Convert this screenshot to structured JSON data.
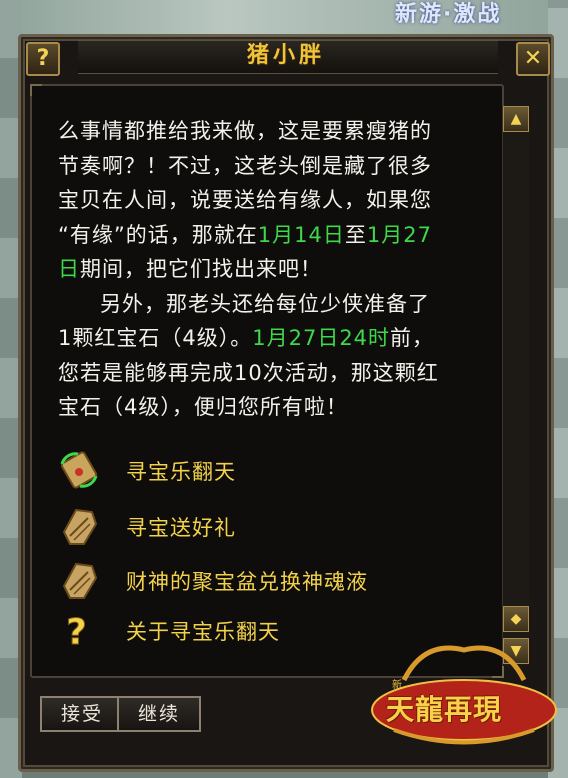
{
  "background": {
    "top_text": "新游·激战"
  },
  "title": "猪小胖",
  "title_bar": {
    "help_icon": "question-icon",
    "close_icon": "close-icon"
  },
  "dialogue": {
    "p1_l1": "么事情都推给我来做，这是要累瘦猪的",
    "p1_l2": "节奏啊？！不过，这老头倒是藏了很多",
    "p1_l3": "宝贝在人间，说要送给有缘人，如果您",
    "p1_l4a": "“有缘”的话，那就在",
    "p1_l4b": "1月14日",
    "p1_l4c": "至",
    "p1_l4d": "1月27",
    "p1_l5a": "日",
    "p1_l5b": "期间，把它们找出来吧！",
    "p2_l1": "另外，那老头还给每位少侠准备了",
    "p2_l2a": "1颗红宝石（4级）。",
    "p2_l2b": "1月27日24时",
    "p2_l2c": "前，",
    "p2_l3": "您若是能够再完成10次活动，那这颗红",
    "p2_l4": "宝石（4级），便归您所有啦！"
  },
  "options": [
    {
      "label": "寻宝乐翻天",
      "icon": "scroll-refresh-icon"
    },
    {
      "label": "寻宝送好礼",
      "icon": "treasure-map-icon"
    },
    {
      "label": "财神的聚宝盆兑换神魂液",
      "icon": "treasure-map-icon"
    },
    {
      "label": "关于寻宝乐翻天",
      "icon": "question-mark-icon"
    }
  ],
  "buttons": {
    "accept": "接受",
    "continue": "继续"
  },
  "logo": {
    "main": "天龍再現",
    "sub": "新"
  },
  "colors": {
    "title": "#f0c33a",
    "highlight": "#3fd84a",
    "option": "#f3d24a",
    "text": "#f4f1ea"
  }
}
